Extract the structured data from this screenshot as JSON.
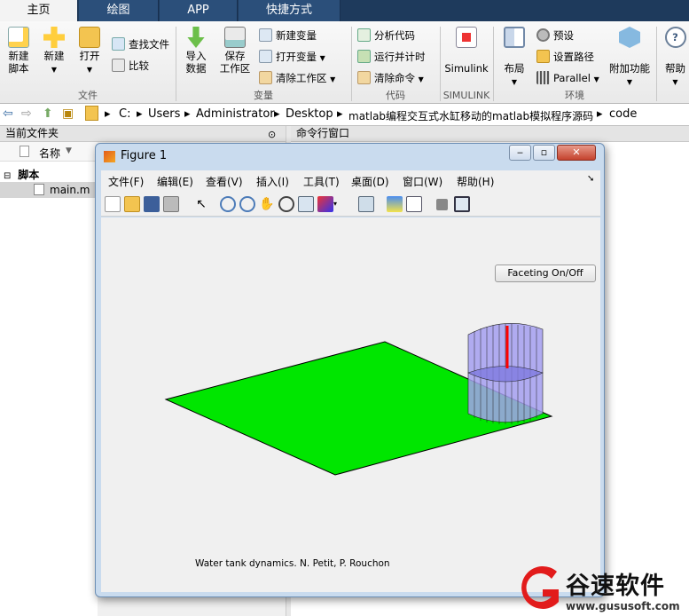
{
  "tabs": [
    "主页",
    "绘图",
    "APP",
    "快捷方式"
  ],
  "ribbon": {
    "new_script": "新建\n脚本",
    "new": "新建",
    "open": "打开",
    "find_files": "查找文件",
    "compare": "比较",
    "import_data": "导入\n数据",
    "save_workspace": "保存\n工作区",
    "new_variable": "新建变量",
    "open_variable": "打开变量",
    "clear_workspace": "清除工作区",
    "analyze_code": "分析代码",
    "run_time": "运行并计时",
    "clear_commands": "清除命令",
    "simulink": "Simulink",
    "layout": "布局",
    "preferences": "预设",
    "set_path": "设置路径",
    "parallel": "Parallel",
    "addons": "附加功能",
    "help": "帮助",
    "groups": [
      "文件",
      "变量",
      "代码",
      "SIMULINK",
      "环境"
    ]
  },
  "address": {
    "crumbs": [
      "C:",
      "Users",
      "Administrator",
      "Desktop",
      "matlab编程交互式水缸移动的matlab模拟程序源码",
      "code"
    ]
  },
  "panels": {
    "current_folder": "当前文件夹",
    "command_window": "命令行窗口",
    "name_col": "名称",
    "folder": "脚本",
    "file": "main.m"
  },
  "figure": {
    "title": "Figure 1",
    "menus": [
      "文件(F)",
      "编辑(E)",
      "查看(V)",
      "插入(I)",
      "工具(T)",
      "桌面(D)",
      "窗口(W)",
      "帮助(H)"
    ],
    "button": "Faceting On/Off",
    "caption": "Water tank dynamics. N. Petit, P. Rouchon"
  },
  "logo": {
    "cn": "谷速软件",
    "url": "www.gususoft.com"
  },
  "colors": {
    "ground": "#00e600",
    "tank": "#a49ff0",
    "rod": "#ff0000",
    "accent": "#1e3a5c"
  }
}
